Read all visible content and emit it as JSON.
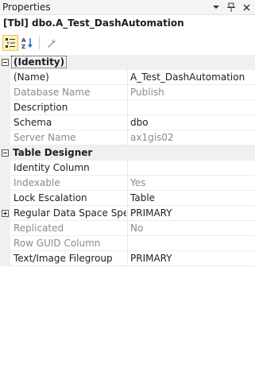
{
  "window": {
    "title": "Properties",
    "dropdown_icon": "chevron-down-icon",
    "pin_icon": "pin-icon",
    "close_icon": "close-icon"
  },
  "object": {
    "title": "[Tbl] dbo.A_Test_DashAutomation"
  },
  "toolbar": {
    "categorized_icon": "categorized-icon",
    "alphabetical_icon": "alphabetical-icon",
    "property_pages_icon": "wrench-icon"
  },
  "grid": {
    "categories": [
      {
        "label": "(Identity)",
        "expanded": true,
        "selected": true,
        "properties": [
          {
            "name": "(Name)",
            "value": "A_Test_DashAutomation",
            "disabled": false,
            "expandable": false
          },
          {
            "name": "Database Name",
            "value": "Publish",
            "disabled": true,
            "expandable": false
          },
          {
            "name": "Description",
            "value": "",
            "disabled": false,
            "expandable": false
          },
          {
            "name": "Schema",
            "value": "dbo",
            "disabled": false,
            "expandable": false
          },
          {
            "name": "Server Name",
            "value": "ax1gis02",
            "disabled": true,
            "expandable": false
          }
        ]
      },
      {
        "label": "Table Designer",
        "expanded": true,
        "selected": false,
        "properties": [
          {
            "name": "Identity Column",
            "value": "",
            "disabled": false,
            "expandable": false
          },
          {
            "name": "Indexable",
            "value": "Yes",
            "disabled": true,
            "expandable": false
          },
          {
            "name": "Lock Escalation",
            "value": "Table",
            "disabled": false,
            "expandable": false
          },
          {
            "name": "Regular Data Space Specification",
            "value": "PRIMARY",
            "disabled": false,
            "expandable": true
          },
          {
            "name": "Replicated",
            "value": "No",
            "disabled": true,
            "expandable": false
          },
          {
            "name": "Row GUID Column",
            "value": "",
            "disabled": true,
            "expandable": false
          },
          {
            "name": "Text/Image Filegroup",
            "value": "PRIMARY",
            "disabled": false,
            "expandable": false
          }
        ]
      }
    ]
  }
}
